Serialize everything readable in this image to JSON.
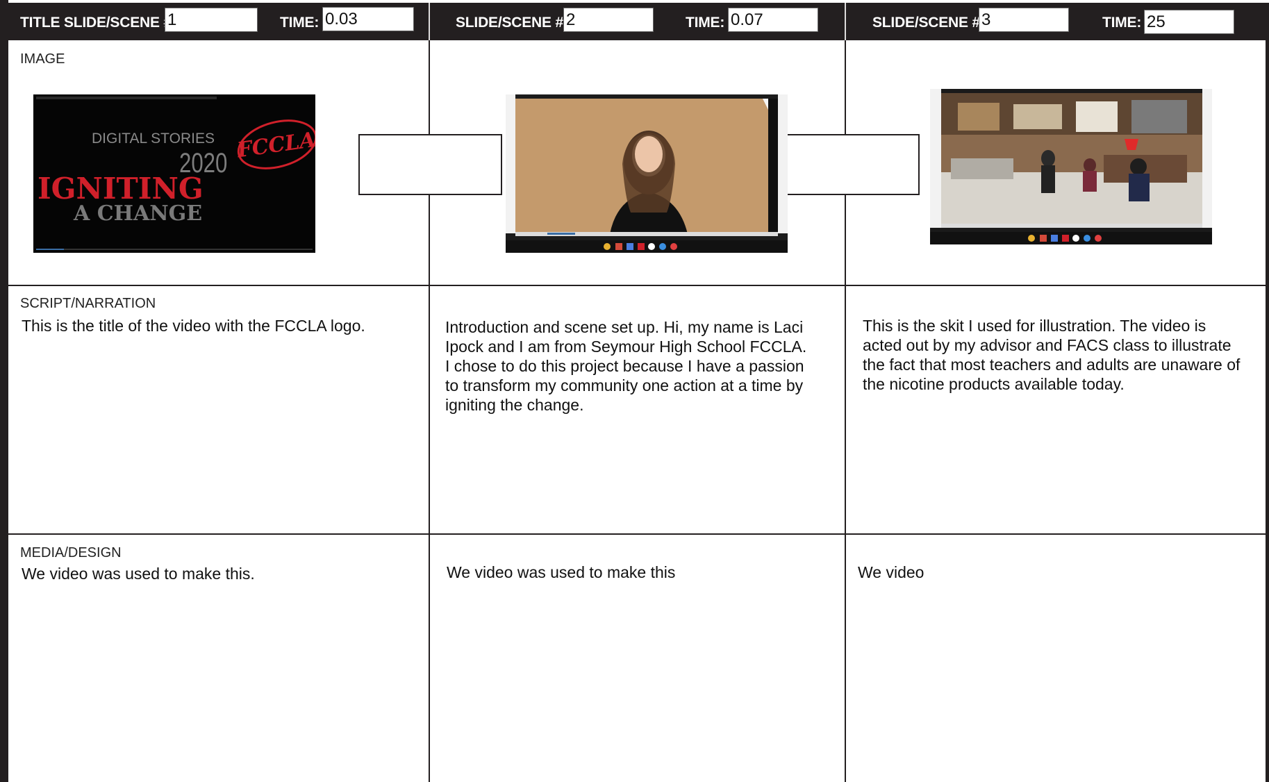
{
  "header": {
    "scene1": {
      "slide_label": "TITLE SLIDE/SCENE #",
      "slide_value": "1",
      "time_label": "TIME:",
      "time_value": "0.03"
    },
    "scene2": {
      "slide_label": "SLIDE/SCENE #",
      "slide_value": "2",
      "time_label": "TIME:",
      "time_value": "0.07"
    },
    "scene3": {
      "slide_label": "SLIDE/SCENE #",
      "slide_value": "3",
      "time_label": "TIME:",
      "time_value": "25"
    }
  },
  "rows": {
    "image_label": "IMAGE",
    "script_label": "SCRIPT/NARRATION",
    "media_label": "MEDIA/DESIGN"
  },
  "image1": {
    "digital_stories": "DIGITAL STORIES",
    "year": "2020",
    "logo": "FCCLA",
    "igniting": "IGNITING",
    "a_change": "A CHANGE"
  },
  "script": {
    "scene1": "This is the title of the video with the FCCLA logo.",
    "scene2_lines": [
      "Introduction and scene set up.  Hi, my name is Laci",
      "Ipock and I am from Seymour High School FCCLA.",
      "I chose to do this project because I have a passion",
      "to transform my community one action at a time by",
      "igniting the change."
    ],
    "scene3_lines": [
      "This is the skit I used for illustration.  The video is",
      "acted out by my advisor and FACS class to illustrate",
      "the fact that most teachers and adults are unaware of",
      "the nicotine products available today."
    ]
  },
  "media": {
    "scene1": "We video was used to make this.",
    "scene2": "We video was used to make this",
    "scene3": "We video"
  },
  "colors": {
    "frame_dark": "#231f20",
    "fccla_red": "#d0202a",
    "cork": "#c49a6c"
  }
}
